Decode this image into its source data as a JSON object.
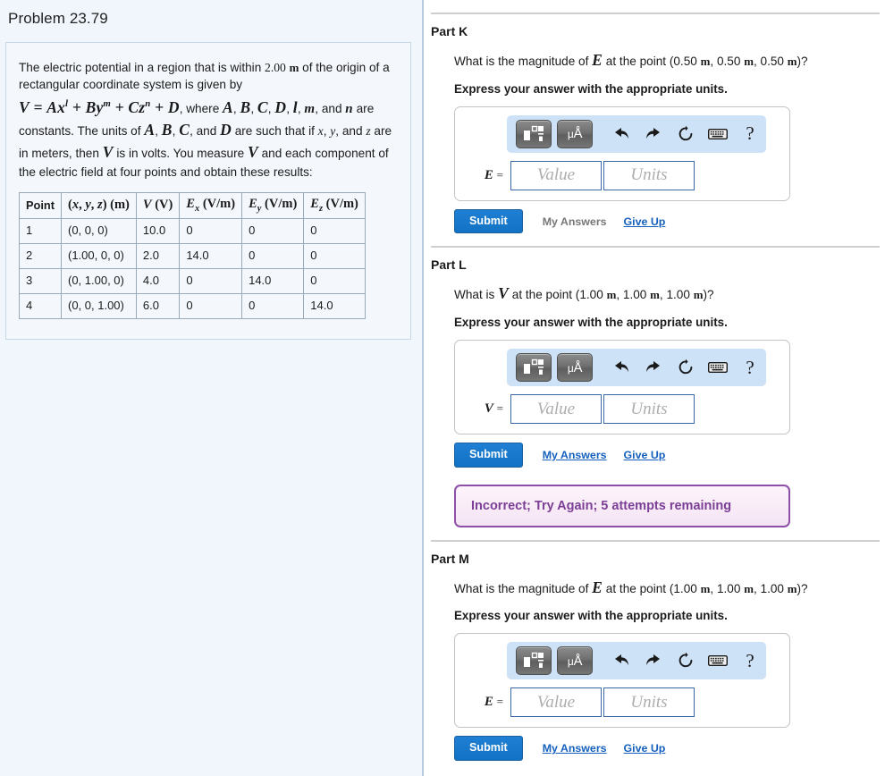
{
  "left": {
    "problem_title": "Problem 23.79",
    "statement_line1": "The electric potential in a region that is within 2.00 m of the origin of a rectangular coordinate system is given by",
    "statement_line2_pre": "where ",
    "statement_line2_post": "are constants. The units of ",
    "statement_line3": "are such that if x, y, and z are in meters, then V is in volts. You measure V and each component of the electric field at four points and obtain these results:",
    "equation": "V = Ax^l + By^m + Cz^n + D",
    "constants_list": "A, B, C, D, l, m, and n",
    "units_list": "A, B, C, and D",
    "distance_value": "2.00",
    "distance_unit": "m",
    "table": {
      "headers": [
        "Point",
        "(x, y, z) (m)",
        "V (V)",
        "Ex (V/m)",
        "Ey (V/m)",
        "Ez (V/m)"
      ],
      "rows": [
        {
          "point": "1",
          "coord": "(0, 0, 0)",
          "v": "10.0",
          "ex": "0",
          "ey": "0",
          "ez": "0"
        },
        {
          "point": "2",
          "coord": "(1.00, 0, 0)",
          "v": "2.0",
          "ex": "14.0",
          "ey": "0",
          "ez": "0"
        },
        {
          "point": "3",
          "coord": "(0, 1.00, 0)",
          "v": "4.0",
          "ex": "0",
          "ey": "14.0",
          "ez": "0"
        },
        {
          "point": "4",
          "coord": "(0, 0, 1.00)",
          "v": "6.0",
          "ex": "0",
          "ey": "0",
          "ez": "14.0"
        }
      ]
    }
  },
  "toolbar": {
    "template_icon": "math-template-icon",
    "units_icon_mu": "μ",
    "units_icon_angstrom": "Å",
    "undo_icon": "undo-arrow-icon",
    "redo_icon": "redo-arrow-icon",
    "reset_icon": "reset-circular-arrow-icon",
    "keyboard_icon": "keyboard-icon",
    "help_label": "?"
  },
  "common": {
    "instruction": "Express your answer with the appropriate units.",
    "value_placeholder": "Value",
    "units_placeholder": "Units",
    "submit_label": "Submit",
    "my_answers_label": "My Answers",
    "give_up_label": "Give Up",
    "equals_sign": "="
  },
  "parts": [
    {
      "id": "k",
      "title": "Part K",
      "question_pre": "What is the magnitude of ",
      "question_symbol": "E",
      "question_post": " at the point (0.50 m, 0.50 m, 0.50 m)?",
      "field_symbol": "E",
      "my_answers_is_link": false,
      "feedback": null
    },
    {
      "id": "l",
      "title": "Part L",
      "question_pre": "What is ",
      "question_symbol": "V",
      "question_post": " at the point (1.00 m, 1.00 m, 1.00 m)?",
      "field_symbol": "V",
      "my_answers_is_link": true,
      "feedback": "Incorrect; Try Again; 5 attempts remaining"
    },
    {
      "id": "m",
      "title": "Part M",
      "question_pre": "What is the magnitude of ",
      "question_symbol": "E",
      "question_post": " at the point (1.00 m, 1.00 m, 1.00 m)?",
      "field_symbol": "E",
      "my_answers_is_link": true,
      "feedback": null
    }
  ],
  "colors": {
    "accent_blue": "#1272c4",
    "link_blue": "#1560bd",
    "toolbar_blue": "#cde1f7",
    "feedback_purple": "#7b3f96",
    "panel_bg": "#f1f6fd"
  }
}
